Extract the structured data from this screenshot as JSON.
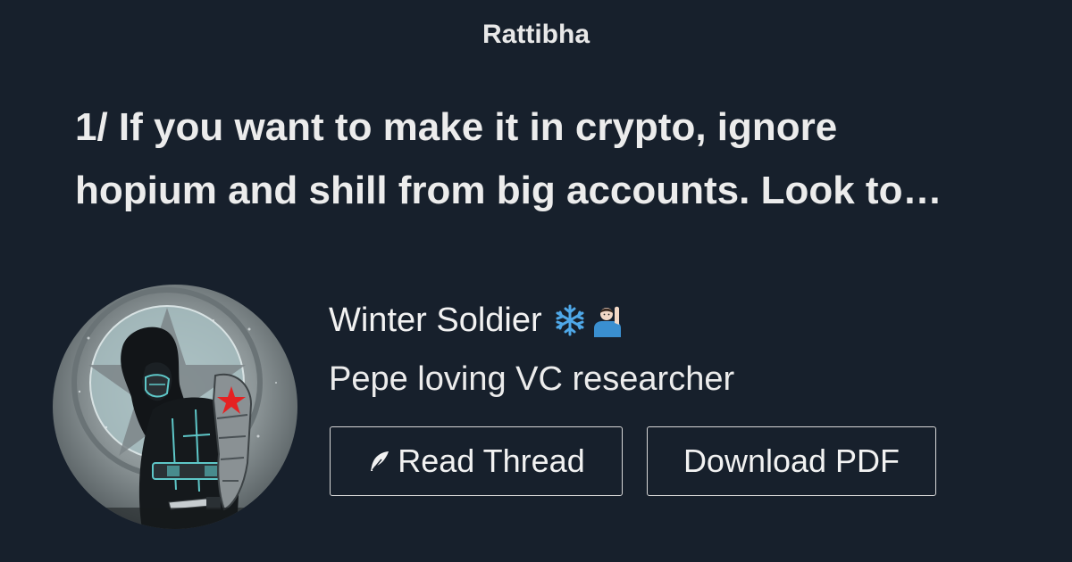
{
  "site": {
    "name": "Rattibha"
  },
  "thread": {
    "title_line1": "1/ If you want to make it in crypto, ignore",
    "title_line2": "hopium and shill from big accounts. Look to…"
  },
  "author": {
    "name": "Winter Soldier",
    "emoji": [
      "snowflake-icon",
      "person-raising-hand-icon"
    ],
    "bio": "Pepe loving VC researcher",
    "avatar_icon": "winter-soldier-avatar"
  },
  "actions": {
    "read_label": "Read Thread",
    "read_icon": "feather-icon",
    "pdf_label": "Download PDF"
  },
  "colors": {
    "background": "#17202c",
    "text": "#f0f0f0",
    "button_border": "#d8d8d8",
    "star_accent": "#e52222",
    "snowflake": "#4fa8e8"
  }
}
